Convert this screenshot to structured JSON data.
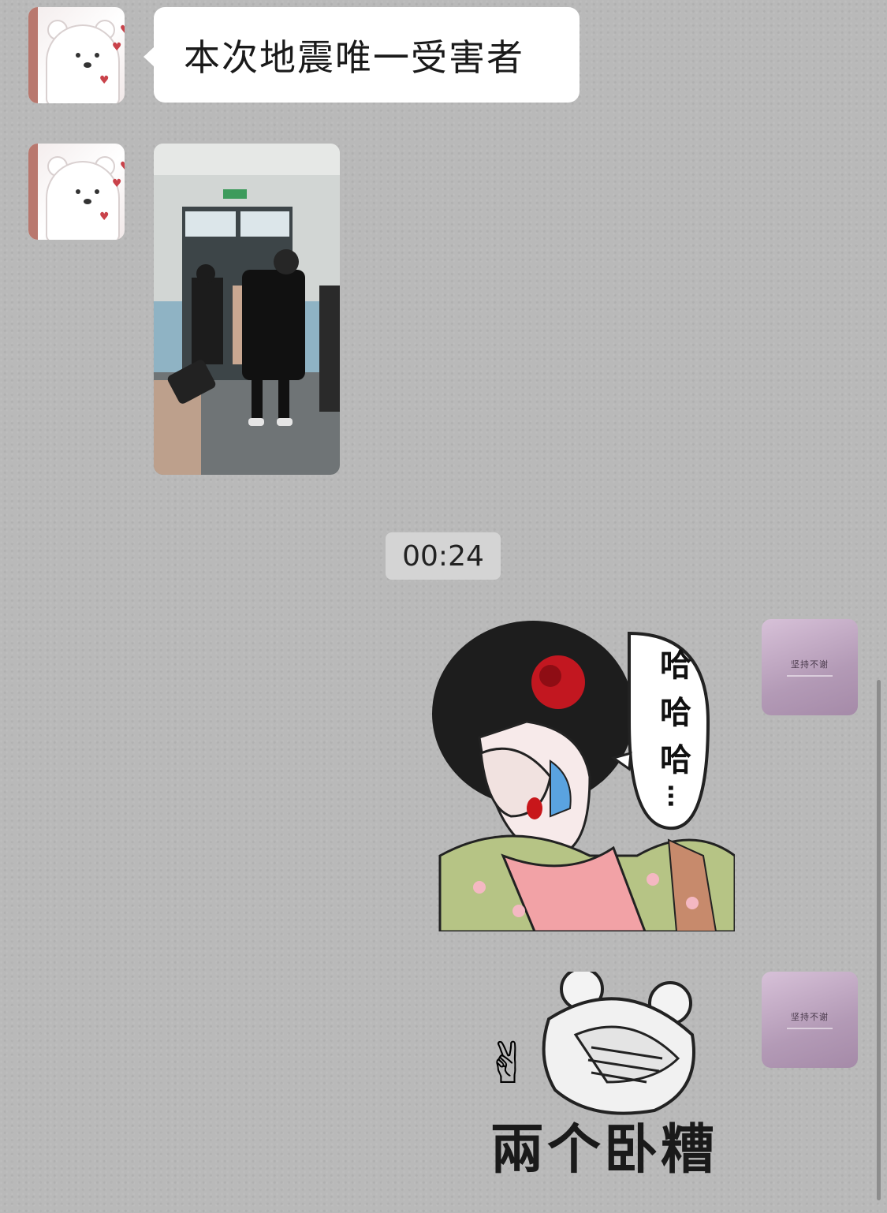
{
  "messages": [
    {
      "id": "m1",
      "sender": "contact",
      "type": "text",
      "text": "本次地震唯一受害者"
    },
    {
      "id": "m2",
      "sender": "contact",
      "type": "image",
      "description": ""
    },
    {
      "id": "m3",
      "type": "timestamp",
      "text": "00:24"
    },
    {
      "id": "m4",
      "sender": "me",
      "type": "sticker",
      "speech_chars": [
        "哈",
        "哈",
        "哈"
      ],
      "speech_trailing": "…"
    },
    {
      "id": "m5",
      "sender": "me",
      "type": "sticker",
      "caption": "兩个卧糟",
      "emoji": "✌"
    }
  ],
  "avatars": {
    "contact_icon": "bear-avatar",
    "me_icon": "calligraphy-avatar",
    "me_text": "坚持不谢"
  },
  "colors": {
    "background": "#b9b9b9",
    "bubble": "#ffffff",
    "timestamp_bg": "#d4d4d4",
    "me_avatar": "#b39ab6"
  }
}
